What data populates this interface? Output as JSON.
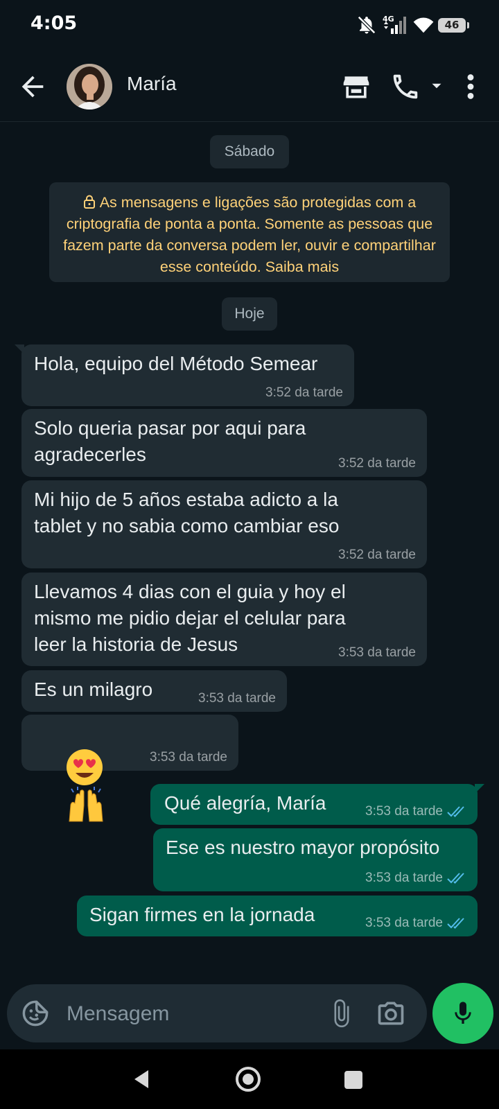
{
  "status_bar": {
    "time": "4:05",
    "network": "4G",
    "battery": "46",
    "icons": [
      "mute-icon",
      "signal-icon",
      "wifi-icon",
      "battery-icon"
    ]
  },
  "header": {
    "contact_name": "María",
    "icons": [
      "back-arrow-icon",
      "store-icon",
      "phone-icon",
      "chevron-down-icon",
      "more-vert-icon"
    ]
  },
  "chat": {
    "date_saturday": "Sábado",
    "encryption_notice": "As mensagens e ligações são protegidas com a criptografia de ponta a ponta. Somente as pessoas que fazem parte da conversa podem ler, ouvir e compartilhar esse conteúdo. Saiba mais",
    "date_today": "Hoje",
    "messages": [
      {
        "direction": "incoming",
        "text": "Hola, equipo del Método Semear",
        "time": "3:52 da tarde"
      },
      {
        "direction": "incoming",
        "text": "Solo queria pasar por aqui para\nagradecerles",
        "time": "3:52 da tarde"
      },
      {
        "direction": "incoming",
        "text": "Mi hijo de 5 años estaba adicto a la\ntablet y no sabia como cambiar eso",
        "time": "3:52 da tarde"
      },
      {
        "direction": "incoming",
        "text": "Llevamos 4 dias con el guia y hoy el\nmismo me pidio dejar el celular para\nleer la historia de Jesus",
        "time": "3:53 da tarde"
      },
      {
        "direction": "incoming",
        "text": "Es un milagro",
        "time": "3:53 da tarde"
      },
      {
        "direction": "incoming",
        "text": "😍🙌",
        "time": "3:53 da tarde"
      },
      {
        "direction": "outgoing",
        "text": "Qué alegría, María",
        "time": "3:53 da tarde",
        "status": "read"
      },
      {
        "direction": "outgoing",
        "text": "Ese es nuestro mayor propósito",
        "time": "3:53 da tarde",
        "status": "read"
      },
      {
        "direction": "outgoing",
        "text": "Sigan firmes en la jornada",
        "time": "3:53 da tarde",
        "status": "read"
      }
    ]
  },
  "composer": {
    "placeholder": "Mensagem",
    "icons": [
      "sticker-icon",
      "paperclip-icon",
      "camera-icon",
      "microphone-icon"
    ]
  },
  "colors": {
    "background": "#0b141a",
    "incoming_bubble": "#202c33",
    "outgoing_bubble": "#005c4b",
    "read_ticks": "#53bdeb",
    "mic_button": "#21c063",
    "notice_text": "#ffd279"
  }
}
